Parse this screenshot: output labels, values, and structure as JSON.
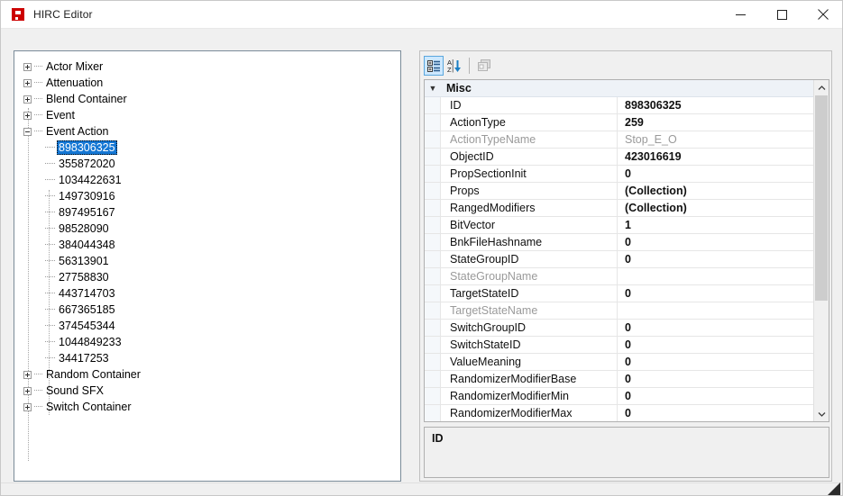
{
  "window": {
    "title": "HIRC Editor",
    "icon": "hirc-app-icon",
    "controls": {
      "minimize": "minimize-icon",
      "maximize": "maximize-icon",
      "close": "close-icon"
    }
  },
  "tree": {
    "nodes": [
      {
        "label": "Actor Mixer",
        "level": 0,
        "state": "collapsed"
      },
      {
        "label": "Attenuation",
        "level": 0,
        "state": "collapsed"
      },
      {
        "label": "Blend Container",
        "level": 0,
        "state": "collapsed"
      },
      {
        "label": "Event",
        "level": 0,
        "state": "collapsed"
      },
      {
        "label": "Event Action",
        "level": 0,
        "state": "expanded"
      },
      {
        "label": "898306325",
        "level": 1,
        "state": "leaf",
        "selected": true
      },
      {
        "label": "355872020",
        "level": 1,
        "state": "leaf",
        "selected": false
      },
      {
        "label": "1034422631",
        "level": 1,
        "state": "leaf",
        "selected": false
      },
      {
        "label": "149730916",
        "level": 1,
        "state": "leaf",
        "selected": false
      },
      {
        "label": "897495167",
        "level": 1,
        "state": "leaf",
        "selected": false
      },
      {
        "label": "98528090",
        "level": 1,
        "state": "leaf",
        "selected": false
      },
      {
        "label": "384044348",
        "level": 1,
        "state": "leaf",
        "selected": false
      },
      {
        "label": "56313901",
        "level": 1,
        "state": "leaf",
        "selected": false
      },
      {
        "label": "27758830",
        "level": 1,
        "state": "leaf",
        "selected": false
      },
      {
        "label": "443714703",
        "level": 1,
        "state": "leaf",
        "selected": false
      },
      {
        "label": "667365185",
        "level": 1,
        "state": "leaf",
        "selected": false
      },
      {
        "label": "374545344",
        "level": 1,
        "state": "leaf",
        "selected": false
      },
      {
        "label": "1044849233",
        "level": 1,
        "state": "leaf",
        "selected": false
      },
      {
        "label": "34417253",
        "level": 1,
        "state": "leaf",
        "selected": false
      },
      {
        "label": "Random Container",
        "level": 0,
        "state": "collapsed"
      },
      {
        "label": "Sound SFX",
        "level": 0,
        "state": "collapsed"
      },
      {
        "label": "Switch Container",
        "level": 0,
        "state": "collapsed"
      }
    ]
  },
  "property_grid": {
    "toolbar": {
      "categorized": {
        "name": "categorized-view-icon",
        "active": true
      },
      "alphabetical": {
        "name": "alphabetical-sort-icon",
        "active": false
      },
      "property_pages": {
        "name": "property-pages-icon",
        "active": false,
        "disabled": true
      }
    },
    "category": {
      "label": "Misc",
      "expanded": true
    },
    "rows": [
      {
        "name": "ID",
        "value": "898306325",
        "readonly": false
      },
      {
        "name": "ActionType",
        "value": "259",
        "readonly": false
      },
      {
        "name": "ActionTypeName",
        "value": "Stop_E_O",
        "readonly": true
      },
      {
        "name": "ObjectID",
        "value": "423016619",
        "readonly": false
      },
      {
        "name": "PropSectionInit",
        "value": "0",
        "readonly": false
      },
      {
        "name": "Props",
        "value": "(Collection)",
        "readonly": false
      },
      {
        "name": "RangedModifiers",
        "value": "(Collection)",
        "readonly": false
      },
      {
        "name": "BitVector",
        "value": "1",
        "readonly": false
      },
      {
        "name": "BnkFileHashname",
        "value": "0",
        "readonly": false
      },
      {
        "name": "StateGroupID",
        "value": "0",
        "readonly": false
      },
      {
        "name": "StateGroupName",
        "value": "",
        "readonly": true
      },
      {
        "name": "TargetStateID",
        "value": "0",
        "readonly": false
      },
      {
        "name": "TargetStateName",
        "value": "",
        "readonly": true
      },
      {
        "name": "SwitchGroupID",
        "value": "0",
        "readonly": false
      },
      {
        "name": "SwitchStateID",
        "value": "0",
        "readonly": false
      },
      {
        "name": "ValueMeaning",
        "value": "0",
        "readonly": false
      },
      {
        "name": "RandomizerModifierBase",
        "value": "0",
        "readonly": false
      },
      {
        "name": "RandomizerModifierMin",
        "value": "0",
        "readonly": false
      },
      {
        "name": "RandomizerModifierMax",
        "value": "0",
        "readonly": false
      }
    ],
    "description": {
      "title": "ID",
      "text": ""
    }
  },
  "colors": {
    "accent": "#1577d4",
    "toolbar_active": "#cde8ff",
    "icon_red": "#cc0000",
    "category_bg": "#eef2f7"
  }
}
